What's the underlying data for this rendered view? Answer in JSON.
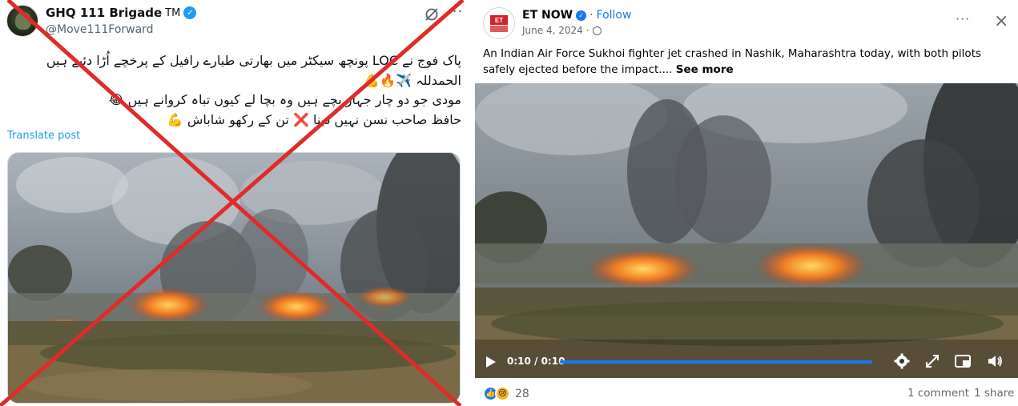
{
  "twitter_post": {
    "display_name": "GHQ 111 Brigade",
    "name_suffix": "TM",
    "handle": "@Move111Forward",
    "text_lines": [
      "پاک فوج نے LOC پونچھ سیکٹر میں بھارتی طیارے رافیل کے پرخچے اُڑا دئیے ہیں",
      "الحمدللہ ✈️🔥💪",
      "مودی جو دو چار جہاز بچے ہیں وہ بچا لے کیوں تباہ کروانے ہیں 😂",
      "حافظ صاحب نسن نہیں دینا ❌ تن کے رکھو شاباش 💪"
    ],
    "translate_label": "Translate post",
    "more_icon": "more-horizontal-icon",
    "grok_icon": "grok-icon",
    "verified_icon": "verified-badge-icon",
    "cross_color": "#e02b2b"
  },
  "facebook_post": {
    "page_name": "ET NOW",
    "logo_text": "ET",
    "follow_label": "Follow",
    "separator": "·",
    "date": "June 4, 2024",
    "audience_icon": "globe-icon",
    "more_icon": "more-horizontal-icon",
    "close_icon": "close-icon",
    "text": "An Indian Air Force Sukhoi fighter jet crashed in Nashik, Maharashtra today, with both pilots safely ejected before the impact....",
    "see_more_label": "See more",
    "video": {
      "time_display": "0:10 / 0:10",
      "progress": 1.0,
      "controls": [
        "play-icon",
        "settings-icon",
        "fullscreen-icon",
        "picture-in-picture-icon",
        "volume-icon"
      ]
    },
    "reactions": [
      "like-icon",
      "sad-icon"
    ],
    "reaction_count": "28",
    "comments_label": "1 comment",
    "shares_label": "1 share",
    "accent_color": "#1877f2"
  }
}
